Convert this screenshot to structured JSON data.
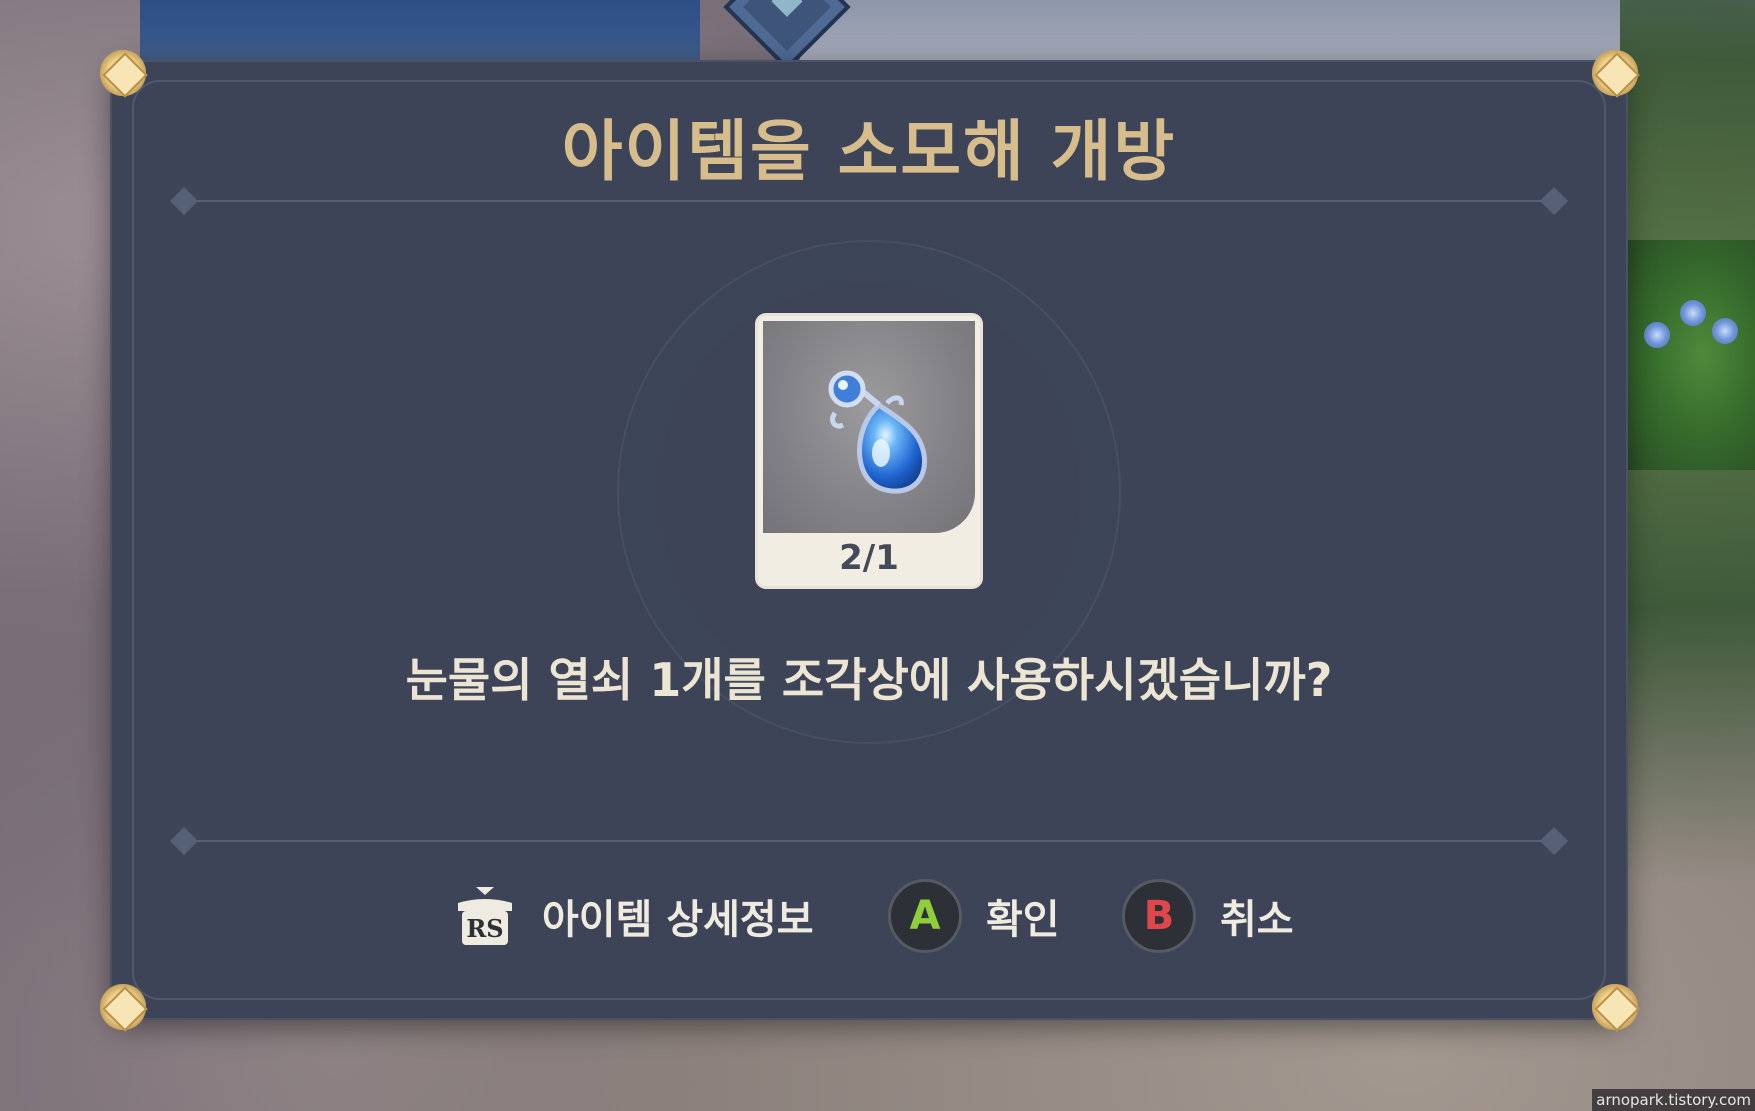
{
  "dialog": {
    "title": "아이템을 소모해 개방",
    "item": {
      "icon": "tear-key-droplet-icon",
      "count_text": "2/1"
    },
    "question": "눈물의 열쇠 1개를 조각상에 사용하시겠습니까?"
  },
  "actions": {
    "details": {
      "button": "RS",
      "label": "아이템 상세정보"
    },
    "confirm": {
      "button": "A",
      "label": "확인",
      "color": "#8fcf3c"
    },
    "cancel": {
      "button": "B",
      "label": "취소",
      "color": "#e0474a"
    }
  },
  "watermark": "arnopark.tistory.com",
  "colors": {
    "panel": "#3d4457",
    "title": "#d7bd8c",
    "text": "#ece5d3",
    "accent_gold": "#f0d48f"
  }
}
